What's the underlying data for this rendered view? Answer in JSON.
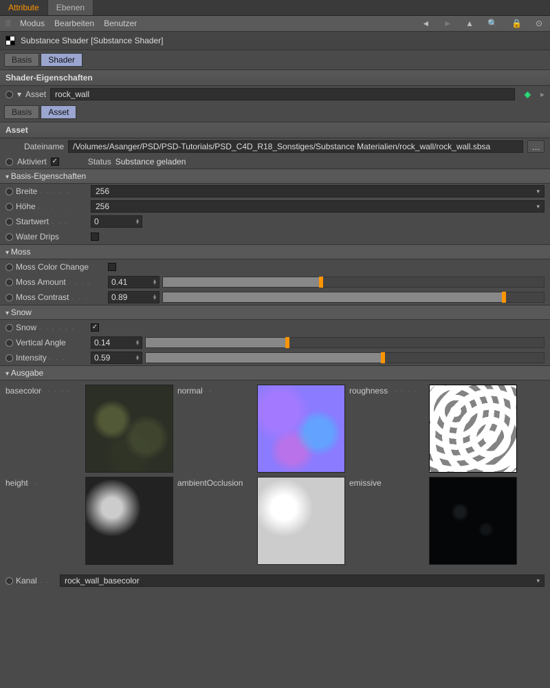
{
  "tabs": {
    "attribute": "Attribute",
    "ebenen": "Ebenen"
  },
  "menu": {
    "modus": "Modus",
    "bearbeiten": "Bearbeiten",
    "benutzer": "Benutzer"
  },
  "title": "Substance Shader [Substance Shader]",
  "main_subtabs": {
    "basis": "Basis",
    "shader": "Shader"
  },
  "shader_props_header": "Shader-Eigenschaften",
  "asset_label": "Asset",
  "asset_name": "rock_wall",
  "asset_subtabs": {
    "basis": "Basis",
    "asset": "Asset"
  },
  "asset_header": "Asset",
  "filename_label": "Dateiname",
  "filename_value": "/Volumes/Asanger/PSD/PSD-Tutorials/PSD_C4D_R18_Sonstiges/Substance Materialien/rock_wall/rock_wall.sbsa",
  "browse": "...",
  "activated_label": "Aktiviert",
  "status_label": "Status",
  "status_value": "Substance geladen",
  "groups": {
    "basis": {
      "header": "Basis-Eigenschaften",
      "breite": {
        "label": "Breite",
        "value": "256"
      },
      "hoehe": {
        "label": "Höhe",
        "value": "256"
      },
      "startwert": {
        "label": "Startwert",
        "value": "0"
      },
      "waterdrips": {
        "label": "Water Drips"
      }
    },
    "moss": {
      "header": "Moss",
      "colorchange": {
        "label": "Moss Color Change"
      },
      "amount": {
        "label": "Moss Amount",
        "value": "0.41",
        "pct": 41
      },
      "contrast": {
        "label": "Moss Contrast",
        "value": "0.89",
        "pct": 89
      }
    },
    "snow": {
      "header": "Snow",
      "snow": {
        "label": "Snow"
      },
      "vangle": {
        "label": "Vertical Angle",
        "value": "0.14",
        "pct": 35
      },
      "intensity": {
        "label": "Intensity",
        "value": "0.59",
        "pct": 59
      }
    },
    "ausgabe": {
      "header": "Ausgabe"
    }
  },
  "outputs": {
    "basecolor": "basecolor",
    "normal": "normal",
    "roughness": "roughness",
    "height": "height",
    "ao": "ambientOcclusion",
    "emissive": "emissive"
  },
  "kanal": {
    "label": "Kanal",
    "value": "rock_wall_basecolor"
  },
  "chart_data": {
    "type": "table",
    "parameters": [
      {
        "name": "Breite",
        "value": 256
      },
      {
        "name": "Höhe",
        "value": 256
      },
      {
        "name": "Startwert",
        "value": 0
      },
      {
        "name": "Water Drips",
        "value": false
      },
      {
        "name": "Moss Color Change",
        "value": false
      },
      {
        "name": "Moss Amount",
        "value": 0.41
      },
      {
        "name": "Moss Contrast",
        "value": 0.89
      },
      {
        "name": "Snow",
        "value": true
      },
      {
        "name": "Vertical Angle",
        "value": 0.14
      },
      {
        "name": "Intensity",
        "value": 0.59
      }
    ]
  }
}
